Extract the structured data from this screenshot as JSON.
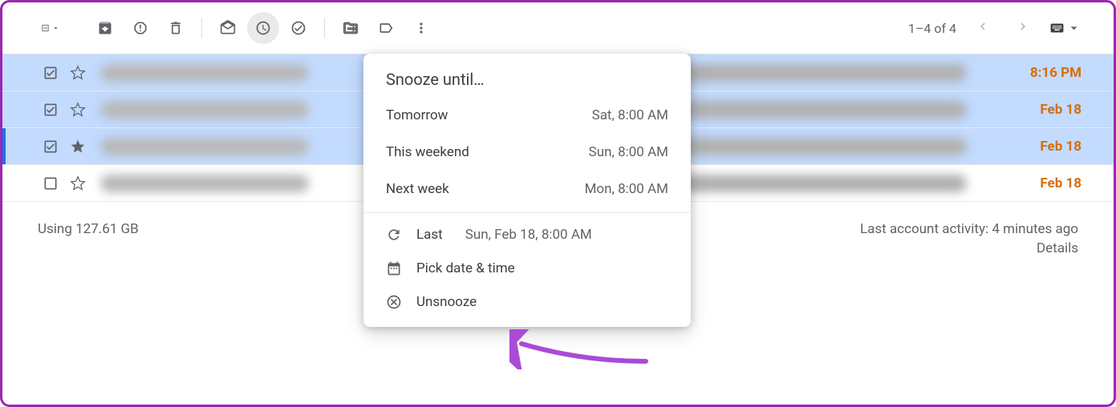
{
  "toolbar": {
    "pagination": "1–4 of 4"
  },
  "emails": [
    {
      "selected": true,
      "starred": false,
      "time": "8:16 PM",
      "active": false
    },
    {
      "selected": true,
      "starred": false,
      "time": "Feb 18",
      "active": false
    },
    {
      "selected": true,
      "starred": true,
      "time": "Feb 18",
      "active": true
    },
    {
      "selected": false,
      "starred": false,
      "time": "Feb 18",
      "active": false
    }
  ],
  "snooze": {
    "title": "Snooze until…",
    "options": [
      {
        "label": "Tomorrow",
        "time": "Sat, 8:00 AM"
      },
      {
        "label": "This weekend",
        "time": "Sun, 8:00 AM"
      },
      {
        "label": "Next week",
        "time": "Mon, 8:00 AM"
      }
    ],
    "last_label": "Last",
    "last_time": "Sun, Feb 18, 8:00 AM",
    "pick_label": "Pick date & time",
    "unsnooze_label": "Unsnooze"
  },
  "footer": {
    "storage": "Using 127.61 GB",
    "activity": "Last account activity: 4 minutes ago",
    "details": "Details"
  }
}
